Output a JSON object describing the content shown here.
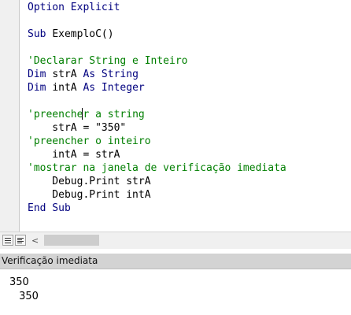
{
  "code_window": {
    "lines": [
      {
        "kind": "kw",
        "text": "Option Explicit"
      },
      {
        "kind": "blank",
        "text": ""
      },
      {
        "kind": "sub",
        "kw": "Sub ",
        "rest": "ExemploC()"
      },
      {
        "kind": "blank",
        "text": ""
      },
      {
        "kind": "cm",
        "text": "'Declarar String e Inteiro"
      },
      {
        "kind": "dim",
        "kw1": "Dim ",
        "mid": "strA ",
        "kw2": "As String"
      },
      {
        "kind": "dim",
        "kw1": "Dim ",
        "mid": "intA ",
        "kw2": "As Integer"
      },
      {
        "kind": "blank",
        "text": ""
      },
      {
        "kind": "cm_caret",
        "before": "'preenche",
        "after": "r a string"
      },
      {
        "kind": "plain",
        "text": "    strA = \"350\""
      },
      {
        "kind": "cm",
        "text": "'preencher o inteiro"
      },
      {
        "kind": "plain",
        "text": "    intA = strA"
      },
      {
        "kind": "cm",
        "text": "'mostrar na janela de verificação imediata"
      },
      {
        "kind": "plain",
        "text": "    Debug.Print strA"
      },
      {
        "kind": "plain",
        "text": "    Debug.Print intA"
      },
      {
        "kind": "kw",
        "text": "End Sub"
      }
    ],
    "colors": {
      "keyword": "#00007f",
      "comment": "#007f00",
      "text": "#000000"
    }
  },
  "toolbar": {
    "procedure_view_icon": "procedure-view-icon",
    "full_module_view_icon": "full-module-view-icon",
    "scroll_left_glyph": "<"
  },
  "immediate_window": {
    "title": "Verificação imediata",
    "output": [
      "350",
      " 350"
    ]
  }
}
